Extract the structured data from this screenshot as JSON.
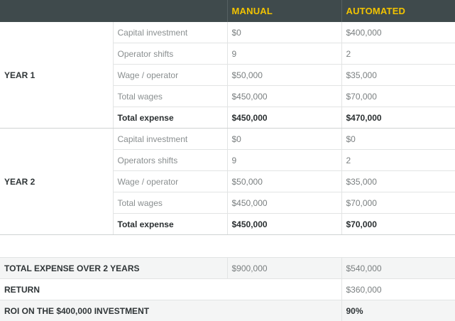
{
  "header": {
    "manual": "MANUAL",
    "automated": "AUTOMATED"
  },
  "years": [
    {
      "label": "YEAR 1",
      "rows": [
        {
          "label": "Capital investment",
          "manual": "$0",
          "automated": "$400,000"
        },
        {
          "label": "Operator shifts",
          "manual": "9",
          "automated": "2"
        },
        {
          "label": "Wage / operator",
          "manual": "$50,000",
          "automated": "$35,000"
        },
        {
          "label": "Total wages",
          "manual": "$450,000",
          "automated": "$70,000"
        },
        {
          "label": "Total expense",
          "manual": "$450,000",
          "automated": "$470,000"
        }
      ]
    },
    {
      "label": "YEAR 2",
      "rows": [
        {
          "label": "Capital investment",
          "manual": "$0",
          "automated": "$0"
        },
        {
          "label": "Operators shifts",
          "manual": "9",
          "automated": "2"
        },
        {
          "label": "Wage / operator",
          "manual": "$50,000",
          "automated": "$35,000"
        },
        {
          "label": "Total wages",
          "manual": "$450,000",
          "automated": "$70,000"
        },
        {
          "label": "Total expense",
          "manual": "$450,000",
          "automated": "$70,000"
        }
      ]
    }
  ],
  "summary": {
    "total_label": "TOTAL EXPENSE OVER 2 YEARS",
    "total_manual": "$900,000",
    "total_automated": "$540,000",
    "return_label": "RETURN",
    "return_value": "$360,000",
    "roi_label": "ROI ON THE $400,000 INVESTMENT",
    "roi_value": "90%"
  }
}
